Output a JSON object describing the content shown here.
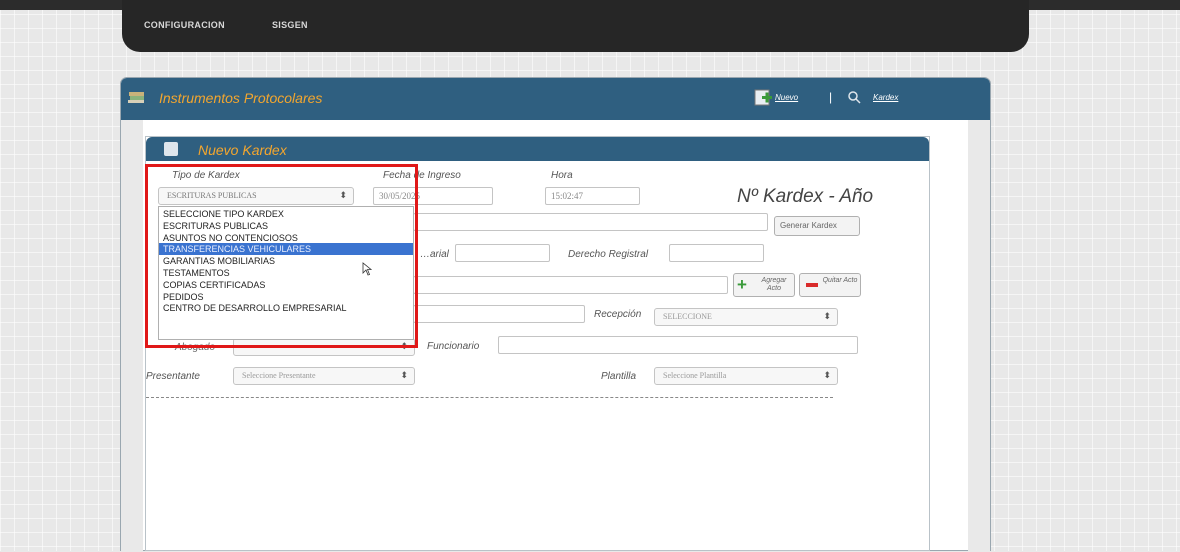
{
  "topnav": {
    "item1": "CONFIGURACION",
    "item2": "SISGEN"
  },
  "window": {
    "title": "Instrumentos Protocolares",
    "nuevo": "Nuevo",
    "sep": "|",
    "kardex": "Kardex"
  },
  "panel": {
    "title": "Nuevo Kardex",
    "tipo_label": "Tipo de Kardex",
    "tipo_value": "ESCRITURAS PUBLICAS",
    "fecha_label": "Fecha de Ingreso",
    "fecha_value": "30/05/2025",
    "hora_label": "Hora",
    "hora_value": "15:02:47",
    "kardex_heading": "Nº Kardex - Año",
    "generar": "Generar Kardex",
    "notarial_label": "…arial",
    "derecho_label": "Derecho Registral",
    "agregar": "Agregar Acto",
    "quitar": "Quitar Acto",
    "recepcion_label": "Recepción",
    "recepcion_value": "SELECCIONE",
    "abogado_label": "Abogado",
    "funcionario_label": "Funcionario",
    "presentante_label": "Presentante",
    "presentante_value": "Seleccione Presentante",
    "plantilla_label": "Plantilla",
    "plantilla_value": "Seleccione Plantilla"
  },
  "dropdown": {
    "options": [
      "SELECCIONE TIPO KARDEX",
      "ESCRITURAS PUBLICAS",
      "ASUNTOS NO CONTENCIOSOS",
      "TRANSFERENCIAS VEHICULARES",
      "GARANTIAS MOBILIARIAS",
      "TESTAMENTOS",
      "COPIAS CERTIFICADAS",
      "PEDIDOS",
      "CENTRO DE DESARROLLO EMPRESARIAL"
    ],
    "highlighted_index": 3
  },
  "colors": {
    "header": "#2f5f80",
    "title_orange": "#f3a62e",
    "highlight": "#3a73d0",
    "annotation_red": "#e01818"
  }
}
